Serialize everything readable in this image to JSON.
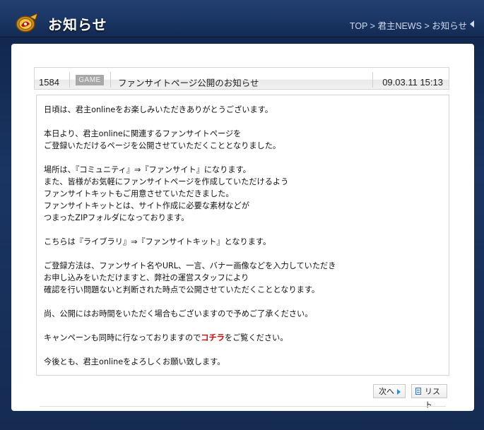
{
  "header": {
    "title": "お知らせ",
    "breadcrumb": [
      "TOP",
      "君主NEWS",
      "お知らせ"
    ],
    "breadcrumb_separator": ">"
  },
  "post": {
    "id": "1584",
    "category": "GAME",
    "title": "ファンサイトページ公開のお知らせ",
    "date": "09.03.11 15:13",
    "body": {
      "p1": "日頃は、君主onlineをお楽しみいただきありがとうございます。",
      "p2_l1": "本日より、君主onlineに関連するファンサイトページを",
      "p2_l2": "ご登録いただけるページを公開させていただくこととなりました。",
      "p3_l1": "場所は、『コミュニティ』⇒『ファンサイト』になります。",
      "p3_l2": "また、皆様がお気軽にファンサイトページを作成していただけるよう",
      "p3_l3": "ファンサイトキットもご用意させていただきました。",
      "p3_l4": "ファンサイトキットとは、サイト作成に必要な素材などが",
      "p3_l5": "つまったZIPフォルダになっております。",
      "p4": "こちらは『ライブラリ』⇒『ファンサイトキット』となります。",
      "p5_l1": "ご登録方法は、ファンサイト名やURL、一言、バナー画像などを入力していただき",
      "p5_l2": "お申し込みをいただけますと、弊社の運営スタッフにより",
      "p5_l3": "確認を行い問題ないと判断された時点で公開させていただくこととなります。",
      "p6": "尚、公開にはお時間をいただく場合もございますので予めご了承ください。",
      "p7_before": "キャンペーンも同時に行なっておりますので",
      "p7_link": "コチラ",
      "p7_after": "をご覧ください。",
      "p8": "今後とも、君主onlineをよろしくお願い致します。"
    }
  },
  "buttons": {
    "next_label": "次へ",
    "list_label": "リスト"
  },
  "icons": {
    "logo": "gold-emblem-logo-icon",
    "breadcrumb_arrow": "triangle-left-icon",
    "next": "triangle-right-icon",
    "list": "list-document-icon"
  },
  "colors": {
    "frame": "#1a3563",
    "badge": "#a8a8a8",
    "link_red": "#d40000",
    "button_icon_blue": "#2b8fd6"
  }
}
